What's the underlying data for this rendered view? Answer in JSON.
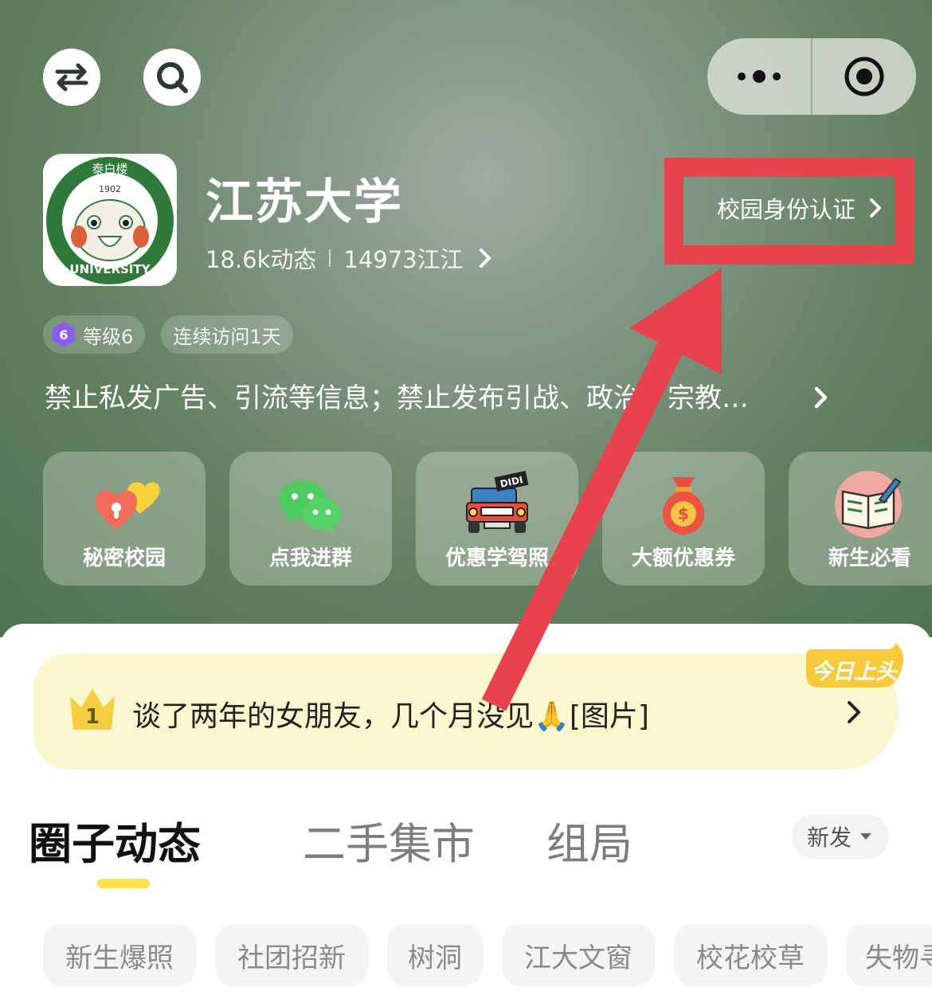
{
  "header": {
    "school_name": "江苏大学",
    "posts_count": "18.6k动态",
    "members_count": "14973江江",
    "verify_label": "校园身份认证",
    "logo": {
      "top_text": "泰白楼",
      "year": "1902",
      "bottom_text": "UNIVERSITY"
    }
  },
  "badges": {
    "level_icon_number": "6",
    "level_label": "等级6",
    "visit_label": "连续访问1天"
  },
  "notice": {
    "text": "禁止私发广告、引流等信息；禁止发布引战、政治、宗教…"
  },
  "quick_entries": [
    {
      "label": "秘密校园",
      "icon": "heart-lock-icon"
    },
    {
      "label": "点我进群",
      "icon": "wechat-icon"
    },
    {
      "label": "优惠学驾照",
      "icon": "jeep-icon",
      "icon_text": "DIDI"
    },
    {
      "label": "大额优惠券",
      "icon": "money-bag-icon",
      "icon_text": "$"
    },
    {
      "label": "新生必看",
      "icon": "book-icon"
    }
  ],
  "hot_post": {
    "rank": "1",
    "badge": "今日上头",
    "text": "谈了两年的女朋友，几个月没见🙏[图片]"
  },
  "tabs": [
    {
      "label": "圈子动态",
      "active": true
    },
    {
      "label": "二手集市",
      "active": false
    },
    {
      "label": "组局",
      "active": false
    }
  ],
  "sort": {
    "label": "新发"
  },
  "categories": [
    "新生爆照",
    "社团招新",
    "树洞",
    "江大文窗",
    "校花校草",
    "失物寻"
  ],
  "colors": {
    "accent_yellow": "#ffe34c",
    "annotation_red": "#e8434c",
    "school_green": "#2f7a3a"
  }
}
